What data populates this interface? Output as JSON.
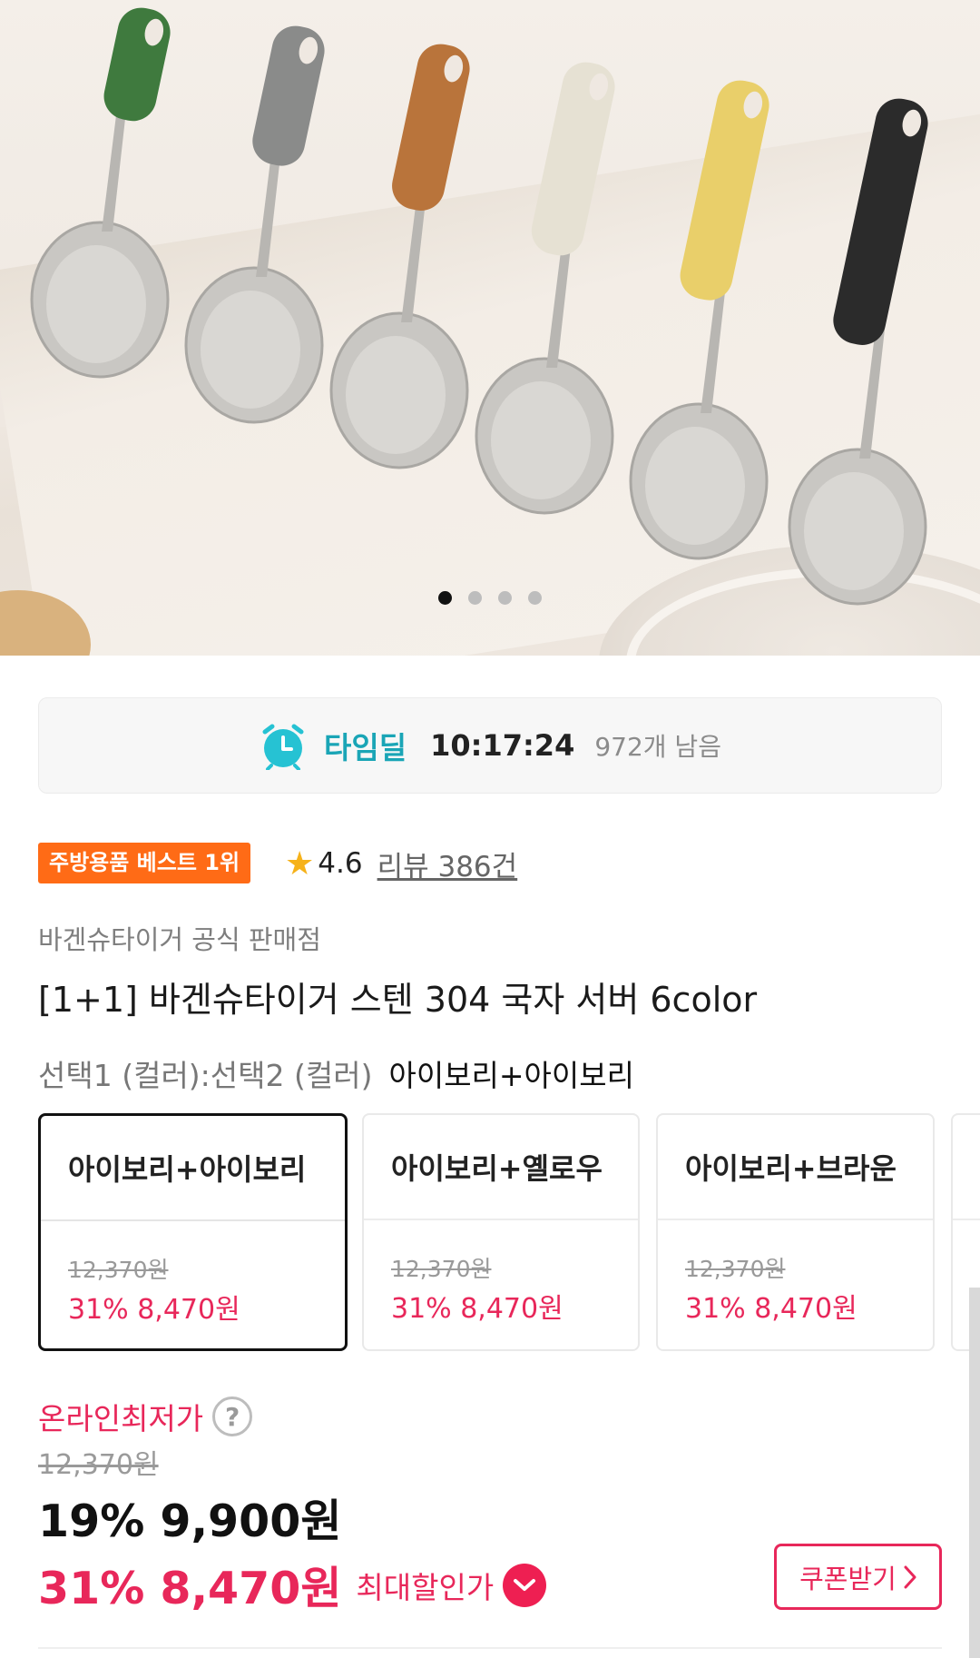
{
  "hero": {
    "carousel_total": 4,
    "carousel_active_index": 1,
    "spoon_colors": [
      "#3f7a3e",
      "#8a8b8a",
      "#b9743b",
      "#e6e1d3",
      "#e9cf6a",
      "#2b2b2b"
    ]
  },
  "time_deal": {
    "title": "타임딜",
    "countdown": "10:17:24",
    "remaining": "972개 남음",
    "accent": "#1aa5b6"
  },
  "badge": {
    "label": "주방용품 베스트 1위",
    "color": "#ff6b16"
  },
  "rating": {
    "score": "4.6",
    "reviews": "리뷰 386건"
  },
  "seller": "바겐슈타이거 공식 판매점",
  "product_title": "[1+1] 바겐슈타이거 스텐 304 국자 서버 6color",
  "options": {
    "label": "선택1 (컬러):선택2 (컬러)",
    "selected_value": "아이보리+아이보리",
    "cards": [
      {
        "name": "아이보리+아이보리",
        "original_price": "12,370원",
        "sale_price": "31% 8,470원",
        "selected": true
      },
      {
        "name": "아이보리+옐로우",
        "original_price": "12,370원",
        "sale_price": "31% 8,470원",
        "selected": false
      },
      {
        "name": "아이보리+브라운",
        "original_price": "12,370원",
        "sale_price": "31% 8,470원",
        "selected": false
      }
    ]
  },
  "price": {
    "lowest_label": "온라인최저가",
    "help_icon": "?",
    "original": "12,370원",
    "main": "19% 9,900원",
    "max_discount": "31% 8,470원",
    "max_discount_label": "최대할인가",
    "coupon_label": "쿠폰받기",
    "accent": "#e8275a"
  }
}
